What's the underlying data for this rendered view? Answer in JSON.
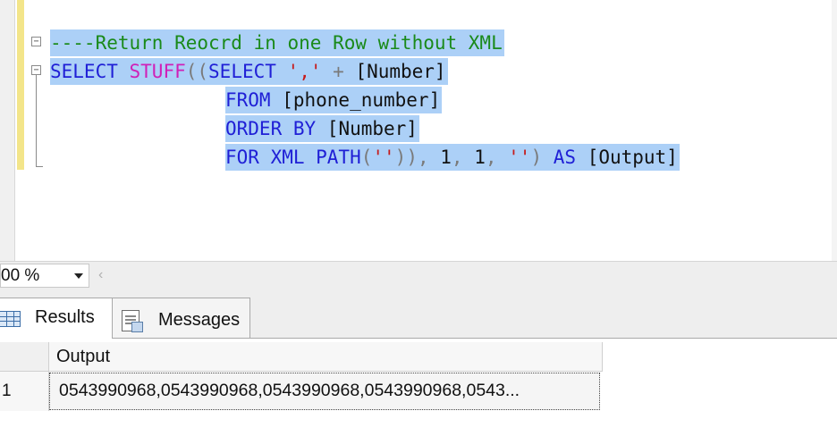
{
  "editor": {
    "lines": [
      {
        "tokens": [
          {
            "t": "cm",
            "v": "----Return Reocrd in one Row without XML"
          }
        ]
      },
      {
        "tokens": [
          {
            "t": "kw",
            "v": "SELECT "
          },
          {
            "t": "fn",
            "v": "STUFF"
          },
          {
            "t": "op",
            "v": "(("
          },
          {
            "t": "kw",
            "v": "SELECT "
          },
          {
            "t": "str",
            "v": "','"
          },
          {
            "t": "op",
            "v": " + "
          },
          {
            "t": "id",
            "v": "[Number]"
          }
        ]
      },
      {
        "tokens": [
          {
            "t": "kw",
            "v": "FROM "
          },
          {
            "t": "id",
            "v": "[phone_number]"
          }
        ]
      },
      {
        "tokens": [
          {
            "t": "kw",
            "v": "ORDER BY "
          },
          {
            "t": "id",
            "v": "[Number]"
          }
        ]
      },
      {
        "tokens": [
          {
            "t": "kw",
            "v": "FOR XML PATH"
          },
          {
            "t": "op",
            "v": "("
          },
          {
            "t": "str",
            "v": "''"
          },
          {
            "t": "op",
            "v": ")), "
          },
          {
            "t": "id",
            "v": "1"
          },
          {
            "t": "op",
            "v": ", "
          },
          {
            "t": "id",
            "v": "1"
          },
          {
            "t": "op",
            "v": ", "
          },
          {
            "t": "str",
            "v": "''"
          },
          {
            "t": "op",
            "v": ") "
          },
          {
            "t": "kw",
            "v": "AS "
          },
          {
            "t": "id",
            "v": "[Output]"
          }
        ]
      }
    ],
    "fold_glyph": "−",
    "selection_color": "#acd0f7"
  },
  "zoom": {
    "value": "00 %",
    "scroll_glyph": "‹"
  },
  "tabs": [
    {
      "label": "Results",
      "icon": "results-grid-icon",
      "active": true
    },
    {
      "label": "Messages",
      "icon": "messages-icon",
      "active": false
    }
  ],
  "grid": {
    "columns": [
      "Output"
    ],
    "rows": [
      {
        "num": "1",
        "cells": [
          "0543990968,0543990968,0543990968,0543990968,0543..."
        ]
      }
    ]
  }
}
